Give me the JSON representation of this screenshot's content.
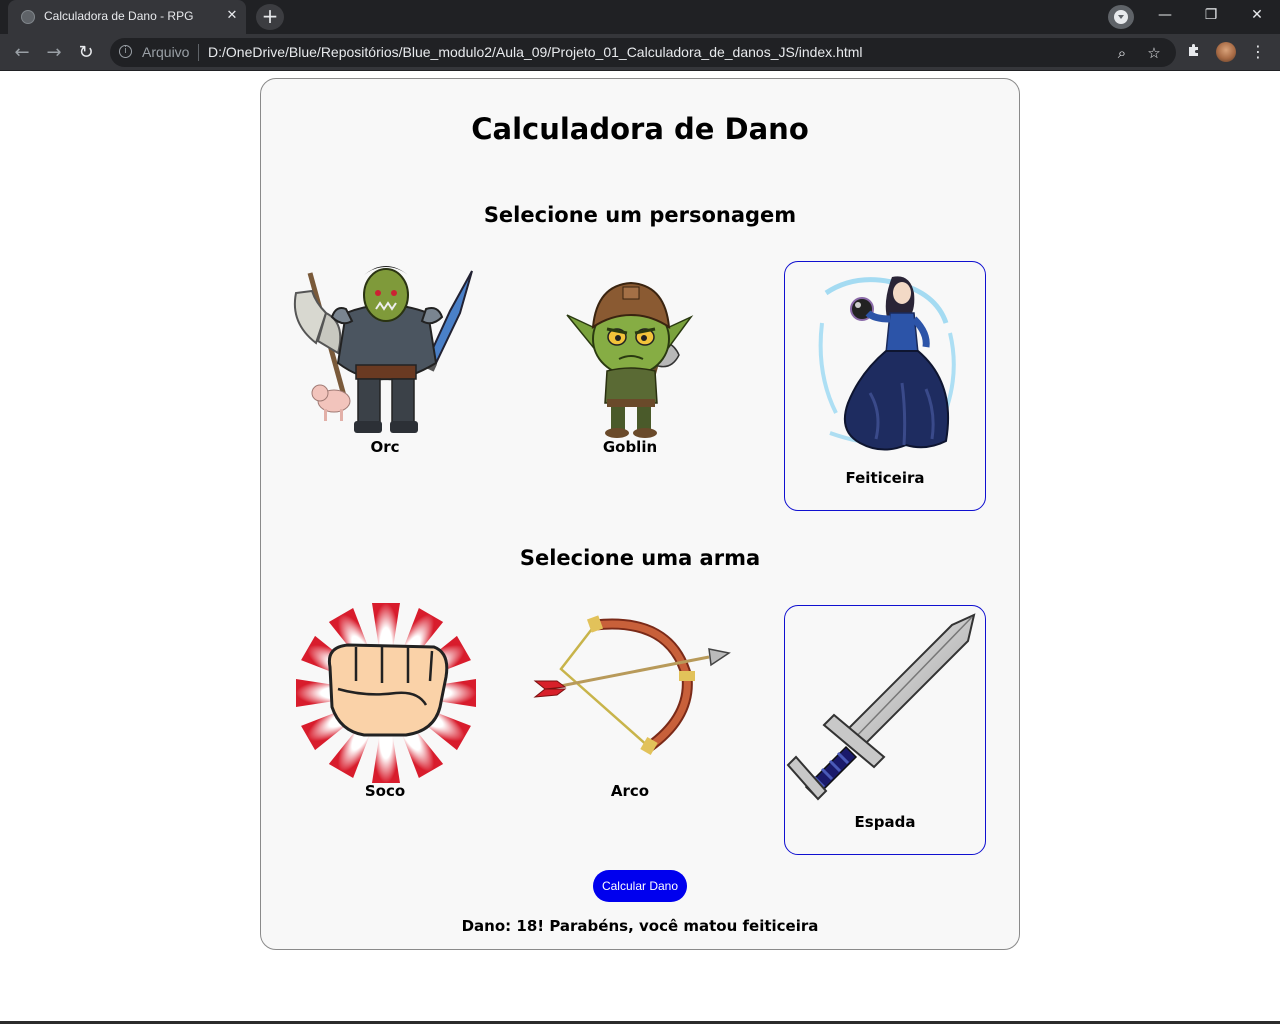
{
  "browser": {
    "tab_title": "Calculadora de Dano - RPG",
    "tab_close": "✕",
    "new_tab": "+",
    "scheme_label": "Arquivo",
    "url": "D:/OneDrive/Blue/Repositórios/Blue_modulo2/Aula_09/Projeto_01_Calculadora_de_danos_JS/index.html",
    "icons": [
      "back-icon",
      "forward-icon",
      "reload-icon",
      "info-icon",
      "zoom-icon",
      "star-icon",
      "extensions-icon",
      "profile-avatar",
      "menu-icon",
      "tab-search-icon"
    ],
    "window_controls": {
      "minimize": "—",
      "restore": "❐",
      "close": "✕"
    }
  },
  "page": {
    "title": "Calculadora de Dano",
    "characters_heading": "Selecione um personagem",
    "characters": [
      {
        "label": "Orc",
        "selected": false,
        "icon": "orc-image"
      },
      {
        "label": "Goblin",
        "selected": false,
        "icon": "goblin-image"
      },
      {
        "label": "Feiticeira",
        "selected": true,
        "icon": "sorceress-image"
      }
    ],
    "weapons_heading": "Selecione uma arma",
    "weapons": [
      {
        "label": "Soco",
        "selected": false,
        "icon": "fist-image"
      },
      {
        "label": "Arco",
        "selected": false,
        "icon": "bow-image"
      },
      {
        "label": "Espada",
        "selected": true,
        "icon": "sword-image"
      }
    ],
    "button_label": "Calcular Dano",
    "result": "Dano: 18! Parabéns, você matou feiticeira",
    "colors": {
      "selected_border": "#1010d0",
      "button_bg": "#0000ee",
      "card_bg": "#f8f8f8"
    }
  }
}
